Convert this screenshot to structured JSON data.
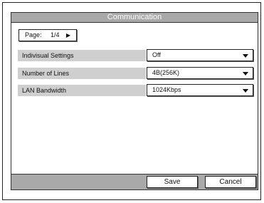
{
  "window": {
    "title": "Communication"
  },
  "pager": {
    "label": "Page:",
    "value": "1/4",
    "next_icon": "right-triangle-icon"
  },
  "settings": [
    {
      "label": "Indivisual Settings",
      "value": "Off"
    },
    {
      "label": "Number of Lines",
      "value": "4B(256K)"
    },
    {
      "label": "LAN Bandwidth",
      "value": "1024Kbps"
    }
  ],
  "footer": {
    "save_label": "Save",
    "cancel_label": "Cancel"
  },
  "colors": {
    "title_bar": "#a9a9a9",
    "label_bg": "#cfcfcf",
    "border": "#222222"
  }
}
